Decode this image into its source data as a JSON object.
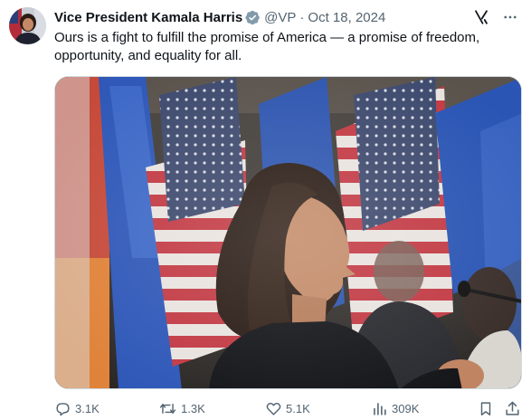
{
  "author": {
    "display_name": "Vice President Kamala Harris",
    "handle": "@VP",
    "separator": "·",
    "date": "Oct 18, 2024",
    "verified_badge_color": "#829aab"
  },
  "tweet": {
    "text": "Ours is a fight to fulfill the promise of America — a promise of freedom, opportunity, and equality for all."
  },
  "icons": {
    "grok": "grok-icon",
    "more": "more-icon",
    "reply": "reply-icon",
    "retweet": "retweet-icon",
    "like": "like-icon",
    "views": "views-icon",
    "bookmark": "bookmark-icon",
    "share": "share-icon"
  },
  "metrics": {
    "replies": "3.1K",
    "reposts": "1.3K",
    "likes": "5.1K",
    "views": "309K"
  },
  "colors": {
    "text_primary": "#0f1419",
    "text_secondary": "#536471",
    "border": "#cfd9de"
  }
}
